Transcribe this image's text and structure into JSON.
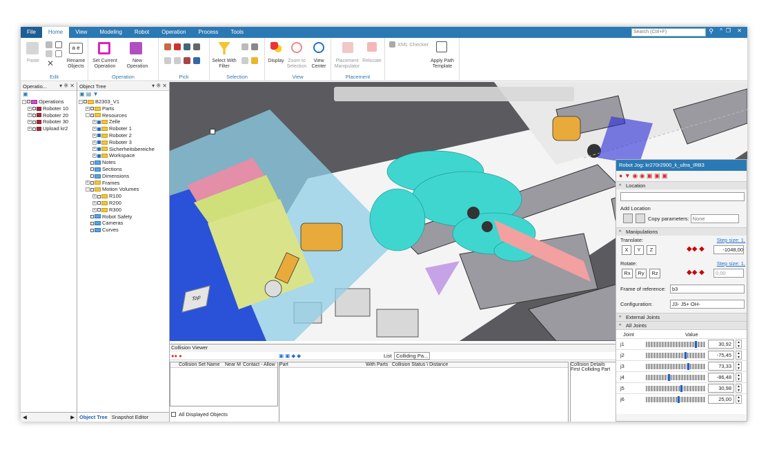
{
  "tabs": [
    "File",
    "Home",
    "View",
    "Modeling",
    "Robot",
    "Operation",
    "Process",
    "Tools"
  ],
  "search_placeholder": "Search (Ctrl+F)",
  "ribbon": {
    "edit": {
      "label": "Edit",
      "paste": "Paste",
      "rename": "Rename Objects"
    },
    "operation": {
      "label": "Operation",
      "set_current": "Set Current Operation",
      "new_op": "New Operation"
    },
    "pick": {
      "label": "Pick"
    },
    "selection": {
      "label": "Selection",
      "select_filter": "Select With Filter"
    },
    "view": {
      "label": "View",
      "display": "Display",
      "zoom_sel": "Zoom to Selection",
      "view_center": "View Center"
    },
    "placement": {
      "label": "Placement",
      "manip": "Placement Manipulator",
      "relocate": "Relocate"
    },
    "xml": "XML Checker",
    "apply_path": "Apply Path Template"
  },
  "operations_panel": {
    "title": "Operatio...",
    "items": [
      "Operations",
      "Roboter 10",
      "Roboter 20",
      "Roboter 30",
      "Upload kr2"
    ]
  },
  "object_tree": {
    "title": "Object Tree",
    "root": "B2303_V1",
    "items": [
      {
        "label": "Parts",
        "lvl": 1
      },
      {
        "label": "Resources",
        "lvl": 1
      },
      {
        "label": "Zelle",
        "lvl": 2
      },
      {
        "label": "Roboter 1",
        "lvl": 2
      },
      {
        "label": "Roboter 2",
        "lvl": 2
      },
      {
        "label": "Roboter 3",
        "lvl": 2
      },
      {
        "label": "Sicherheitsbereiche",
        "lvl": 2
      },
      {
        "label": "Workspace",
        "lvl": 2
      },
      {
        "label": "Notes",
        "lvl": 1
      },
      {
        "label": "Sections",
        "lvl": 1
      },
      {
        "label": "Dimensions",
        "lvl": 1
      },
      {
        "label": "Frames",
        "lvl": 1
      },
      {
        "label": "Motion Volumes",
        "lvl": 1
      },
      {
        "label": "R100",
        "lvl": 2
      },
      {
        "label": "R200",
        "lvl": 2
      },
      {
        "label": "R300",
        "lvl": 2
      },
      {
        "label": "Robot Safety",
        "lvl": 1
      },
      {
        "label": "Cameras",
        "lvl": 1
      },
      {
        "label": "Curves",
        "lvl": 1
      }
    ],
    "bottom_tabs": [
      "Object Tree",
      "Snapshot Editor"
    ]
  },
  "collision": {
    "title": "Collision Viewer",
    "list_label": "List",
    "list_value": "Colliding Pa...",
    "cols1": [
      "Collision Set Name",
      "Near M",
      "Contact - Allow"
    ],
    "cols2": [
      "Part",
      "With Parts",
      "Collision Status \\ Distance"
    ],
    "details": [
      "Collision Details",
      "First Colliding Part"
    ],
    "all_displayed": "All Displayed Objects"
  },
  "cube_label": "Top",
  "jog": {
    "title": "Robot Jog: kr270r2900_k_ultra_IRB3",
    "location": "Location",
    "add_location": "Add Location",
    "copy_params": "Copy parameters:",
    "copy_value": "None",
    "manipulations": "Manipulations",
    "translate": "Translate:",
    "step1": "Step size: 1,",
    "rotate": "Rotate:",
    "step2": "Step size: 1,",
    "t_axes": [
      "X",
      "Y",
      "Z"
    ],
    "r_axes": [
      "Rx",
      "Ry",
      "Rz"
    ],
    "t_value": "-1048,00",
    "r_value": "0,00",
    "frame_label": "Frame of reference:",
    "frame_value": "b3",
    "config_label": "Configuration:",
    "config_value": "J3- J5+ OH-",
    "external": "External Joints",
    "all_joints": "All Joints",
    "joint_hdr": "Joint",
    "value_hdr": "Value",
    "joints": [
      {
        "name": "j1",
        "val": "30,92",
        "pos": 0.86
      },
      {
        "name": "j2",
        "val": "-75,45",
        "pos": 0.68
      },
      {
        "name": "j3",
        "val": "73,33",
        "pos": 0.72
      },
      {
        "name": "j4",
        "val": "-86,48",
        "pos": 0.38
      },
      {
        "name": "j5",
        "val": "30,98",
        "pos": 0.6
      },
      {
        "name": "j6",
        "val": "25,00",
        "pos": 0.55
      }
    ]
  }
}
